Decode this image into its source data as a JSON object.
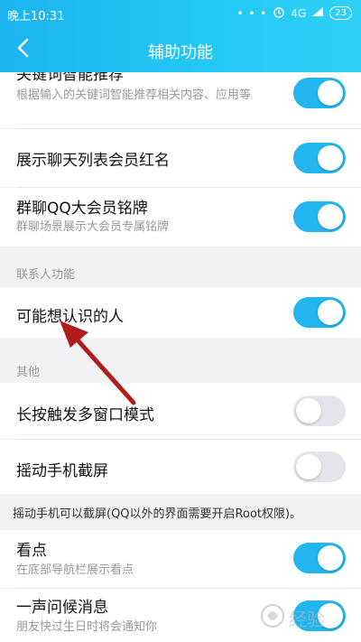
{
  "status": {
    "time": "晚上10:31",
    "network": "4G",
    "battery": "23"
  },
  "nav": {
    "title": "辅助功能"
  },
  "rows": [
    {
      "title": "关键词智能推荐",
      "sub": "根据输入的关键词智能推荐相关内容、应用等",
      "on": true
    },
    {
      "title": "展示聊天列表会员红名",
      "on": true
    },
    {
      "title": "群聊QQ大会员铭牌",
      "sub": "群聊场景展示大会员专属铭牌",
      "on": true
    },
    {
      "title": "可能想认识的人",
      "on": true
    },
    {
      "title": "长按触发多窗口模式",
      "on": false
    },
    {
      "title": "摇动手机截屏",
      "on": false
    },
    {
      "title": "看点",
      "sub": "在底部导航栏展示看点",
      "on": true
    },
    {
      "title": "一声问候消息",
      "sub": "朋友快过生日时将会通知你",
      "on": true
    }
  ],
  "sections": {
    "contacts": "联系人功能",
    "other": "其他"
  },
  "note": "摇动手机可以截屏(QQ以外的界面需要开启Root权限)。",
  "watermark": {
    "text": "经验"
  },
  "colors": {
    "accent": "#22b5f0",
    "toggle_off": "#e4e4ea",
    "arrow": "#b01d1d"
  },
  "icons": [
    "back-arrow-icon",
    "alarm-icon",
    "signal-icon",
    "battery-icon"
  ]
}
